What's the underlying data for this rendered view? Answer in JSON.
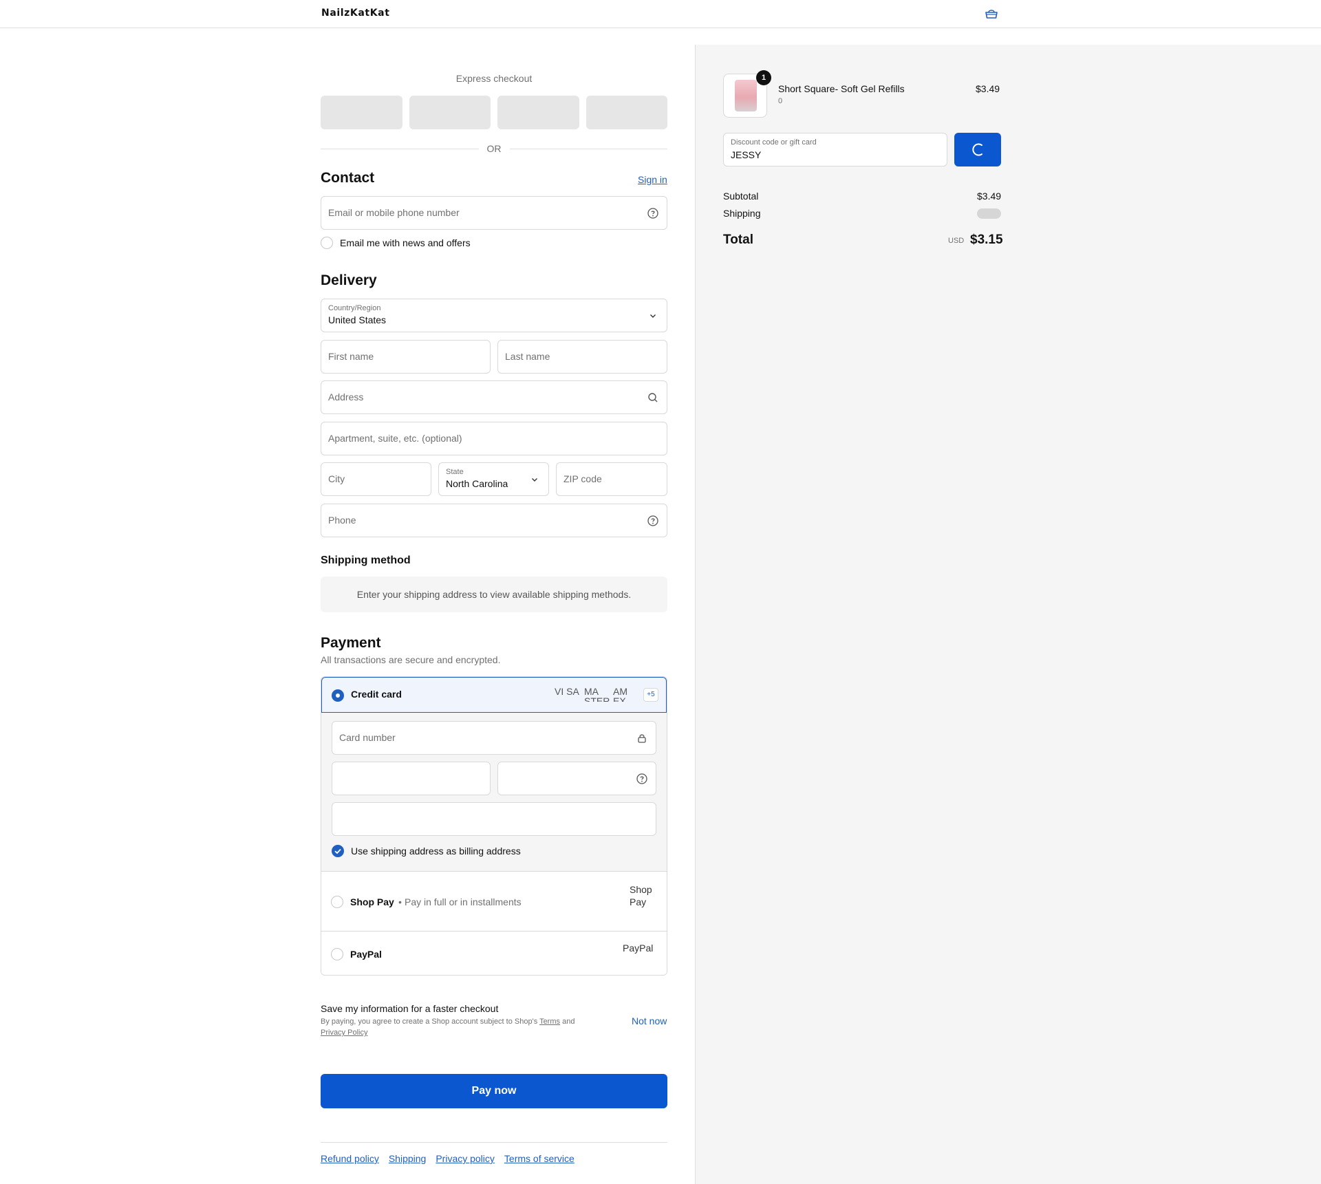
{
  "header": {
    "logo": "NailzKatKat",
    "cart_icon": "cart-icon"
  },
  "express": {
    "title": "Express checkout",
    "or_text": "OR",
    "button_count": 4
  },
  "contact": {
    "heading": "Contact",
    "sign_in": "Sign in",
    "email_placeholder": "Email or mobile phone number",
    "news_label": "Email me with news and offers"
  },
  "delivery": {
    "heading": "Delivery",
    "country_label": "Country/Region",
    "country_value": "United States",
    "first_name_placeholder": "First name",
    "last_name_placeholder": "Last name",
    "address_placeholder": "Address",
    "apartment_placeholder": "Apartment, suite, etc. (optional)",
    "city_placeholder": "City",
    "state_label": "State",
    "state_value": "North Carolina",
    "zip_placeholder": "ZIP code",
    "phone_placeholder": "Phone"
  },
  "shipping_method": {
    "heading": "Shipping method",
    "info": "Enter your shipping address to view available shipping methods."
  },
  "payment": {
    "heading": "Payment",
    "subtitle": "All transactions are secure and encrypted.",
    "credit_card_label": "Credit card",
    "card_logos": [
      "VISA",
      "MASTERCARD",
      "AMEX"
    ],
    "card_logo_alts": [
      "VI SA",
      "MA STER",
      "AM EX"
    ],
    "more_cards": "+5",
    "card_number_placeholder": "Card number",
    "billing_label": "Use shipping address as billing address",
    "shop_pay_label": "Shop Pay",
    "shop_pay_sub": "Pay in full or in installments",
    "shop_pay_alt": "Shop Pay",
    "paypal_label": "PayPal",
    "paypal_alt": "PayPal"
  },
  "save_info": {
    "title": "Save my information for a faster checkout",
    "sub_prefix": "By paying, you agree to create a Shop account subject to Shop's",
    "terms": "Terms",
    "and": "and",
    "privacy": "Privacy Policy",
    "not_now": "Not now"
  },
  "pay_now": "Pay now",
  "footer": {
    "links": [
      "Refund policy",
      "Shipping",
      "Privacy policy",
      "Terms of service"
    ]
  },
  "summary": {
    "item": {
      "quantity": "1",
      "name": "Short Square- Soft Gel Refills",
      "variant": "0",
      "price": "$3.49"
    },
    "discount_label": "Discount code or gift card",
    "discount_value": "JESSY",
    "subtotal_label": "Subtotal",
    "subtotal_value": "$3.49",
    "shipping_label": "Shipping",
    "total_label": "Total",
    "currency": "USD",
    "total_value": "$3.15"
  },
  "colors": {
    "accent": "#0a57d0",
    "link": "#1f5fbf",
    "summary_bg": "#f5f5f5"
  }
}
